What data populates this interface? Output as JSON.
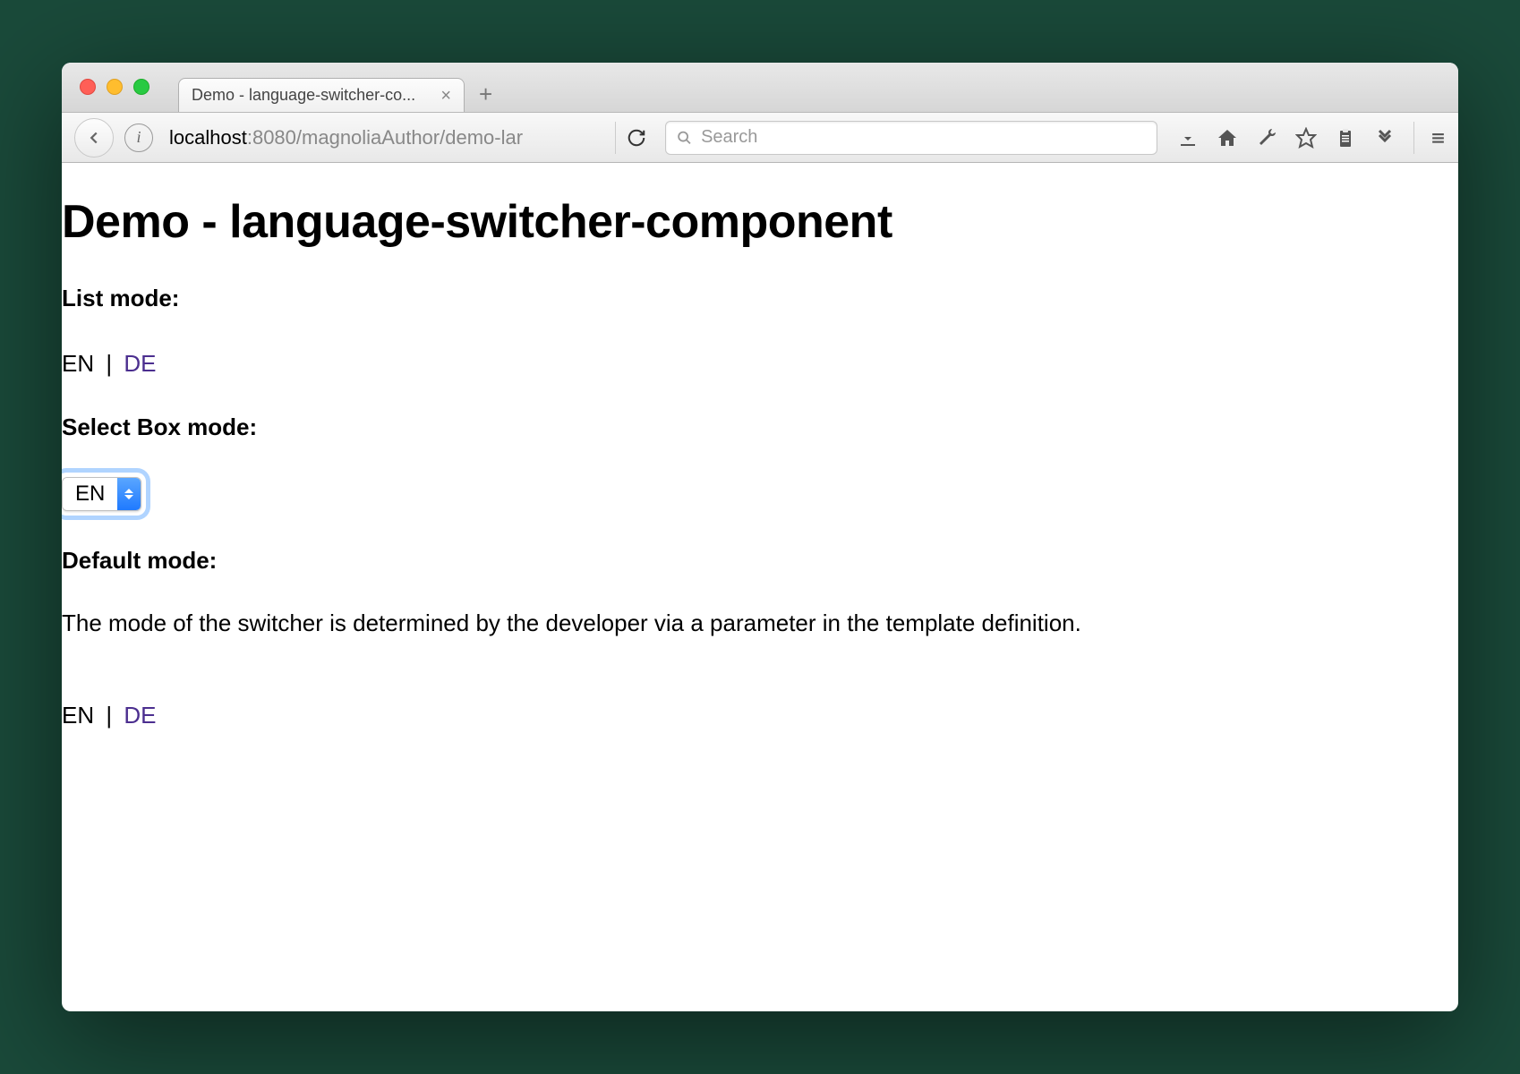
{
  "tab": {
    "title": "Demo - language-switcher-co..."
  },
  "url": {
    "host": "localhost",
    "port": ":8080",
    "path": "/magnoliaAuthor/demo-lar"
  },
  "search": {
    "placeholder": "Search"
  },
  "page": {
    "title": "Demo - language-switcher-component",
    "list_mode_heading": "List mode:",
    "list_mode": {
      "current": "EN",
      "separator": "|",
      "other": "DE"
    },
    "select_mode_heading": "Select Box mode:",
    "select_value": "EN",
    "default_mode_heading": "Default mode:",
    "description": "The mode of the switcher is determined by the developer via a parameter in the template definition.",
    "default_list": {
      "current": "EN",
      "separator": "|",
      "other": "DE"
    }
  }
}
